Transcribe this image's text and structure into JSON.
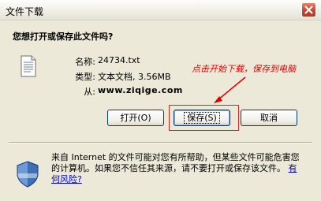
{
  "window": {
    "title": "文件下载"
  },
  "dialog": {
    "question": "您想打开或保存此文件吗?",
    "fields": [
      {
        "label": "名称:",
        "value": "24734.txt"
      },
      {
        "label": "类型:",
        "value": "文本文档, 3.56MB"
      },
      {
        "label": "从:",
        "value": "www.ziqige.com"
      }
    ],
    "annotation": "点击开始下载，保存到电脑",
    "buttons": {
      "open": "打开(O)",
      "save": "保存(S)",
      "cancel": "取消"
    },
    "warning_text": "来自 Internet 的文件可能对您有所帮助，但某些文件可能危害您的计算机。如果您不信任其来源，请不要打开或保存该文件。",
    "risk_link": "有何风险?"
  },
  "icons": {
    "file": "text-file-icon",
    "shield": "security-shield-icon",
    "close": "close-icon"
  },
  "colors": {
    "annotation": "#e00000",
    "close_button": "#c7462f",
    "dialog_bg": "#ece9d8"
  }
}
